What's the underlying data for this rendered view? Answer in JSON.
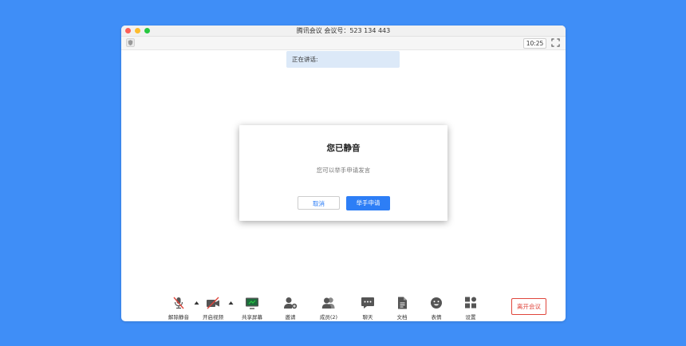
{
  "window": {
    "title": "腾讯会议 会议号：523 134 443",
    "time": "10:25",
    "speaking_label": "正在讲话:"
  },
  "dialog": {
    "title": "您已静音",
    "message": "您可以举手申请发言",
    "cancel_label": "取消",
    "raise_hand_label": "举手申请"
  },
  "toolbar": {
    "items": [
      {
        "label": "解除静音",
        "icon": "microphone-muted-icon"
      },
      {
        "label": "开启视频",
        "icon": "video-off-icon"
      },
      {
        "label": "共享屏幕",
        "icon": "share-screen-icon"
      },
      {
        "label": "邀请",
        "icon": "invite-user-icon"
      },
      {
        "label": "成员(2)",
        "icon": "members-icon"
      },
      {
        "label": "聊天",
        "icon": "chat-icon"
      },
      {
        "label": "文档",
        "icon": "document-icon"
      },
      {
        "label": "表情",
        "icon": "emoji-icon"
      },
      {
        "label": "设置",
        "icon": "settings-icon"
      }
    ],
    "leave_label": "离开会议"
  },
  "colors": {
    "background": "#3f8ef7",
    "accent": "#2d7ef6",
    "danger": "#e0463c",
    "speaking_bg": "#dce9f8"
  }
}
